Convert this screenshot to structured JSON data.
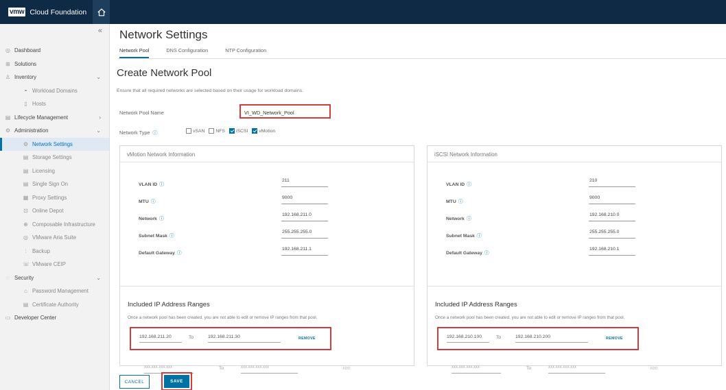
{
  "header": {
    "logo": "vmw",
    "title": "Cloud Foundation",
    "home_icon": "home-icon"
  },
  "sidebar": {
    "collapse": "«",
    "items": [
      {
        "label": "Dashboard",
        "icon": "dashboard-icon",
        "level": "top"
      },
      {
        "label": "Solutions",
        "icon": "solutions-icon",
        "level": "top"
      },
      {
        "label": "Inventory",
        "icon": "inventory-icon",
        "level": "top",
        "chevron": "⌄"
      },
      {
        "label": "Workload Domains",
        "icon": "workload-icon",
        "level": "sub"
      },
      {
        "label": "Hosts",
        "icon": "host-icon",
        "level": "sub"
      },
      {
        "label": "Lifecycle Management",
        "icon": "lifecycle-icon",
        "level": "top",
        "chevron": "›"
      },
      {
        "label": "Administration",
        "icon": "admin-icon",
        "level": "top",
        "chevron": "⌄"
      },
      {
        "label": "Network Settings",
        "icon": "network-icon",
        "level": "sub",
        "active": true
      },
      {
        "label": "Storage Settings",
        "icon": "storage-icon",
        "level": "sub"
      },
      {
        "label": "Licensing",
        "icon": "licensing-icon",
        "level": "sub"
      },
      {
        "label": "Single Sign On",
        "icon": "sso-icon",
        "level": "sub"
      },
      {
        "label": "Proxy Settings",
        "icon": "proxy-icon",
        "level": "sub"
      },
      {
        "label": "Online Depot",
        "icon": "depot-icon",
        "level": "sub"
      },
      {
        "label": "Composable Infrastructure",
        "icon": "composable-icon",
        "level": "sub"
      },
      {
        "label": "VMware Aria Suite",
        "icon": "aria-icon",
        "level": "sub"
      },
      {
        "label": "Backup",
        "icon": "backup-icon",
        "level": "sub"
      },
      {
        "label": "VMware CEIP",
        "icon": "ceip-icon",
        "level": "sub"
      },
      {
        "label": "Security",
        "icon": "security-icon",
        "level": "top",
        "chevron": "⌄"
      },
      {
        "label": "Password Management",
        "icon": "password-icon",
        "level": "sub"
      },
      {
        "label": "Certificate Authority",
        "icon": "certificate-icon",
        "level": "sub"
      },
      {
        "label": "Developer Center",
        "icon": "developer-icon",
        "level": "top"
      }
    ]
  },
  "main": {
    "title": "Network Settings",
    "tabs": [
      "Network Pool",
      "DNS Configuration",
      "NTP Configuration"
    ],
    "form_title": "Create Network Pool",
    "description": "Ensure that all required networks are selected based on their usage for workload domains.",
    "pool_name_label": "Network Pool Name",
    "pool_name_value": "VI_WD_Network_Pool",
    "network_type_label": "Network Type",
    "network_types": [
      {
        "label": "vSAN",
        "checked": false
      },
      {
        "label": "NFS",
        "checked": false
      },
      {
        "label": "iSCSI",
        "checked": true
      },
      {
        "label": "vMotion",
        "checked": true
      }
    ]
  },
  "cards": {
    "vmotion": {
      "title": "vMotion Network Information",
      "fields": [
        {
          "label": "VLAN ID",
          "value": "211"
        },
        {
          "label": "MTU",
          "value": "9000"
        },
        {
          "label": "Network",
          "value": "192.168.211.0"
        },
        {
          "label": "Subnet Mask",
          "value": "255.255.255.0"
        },
        {
          "label": "Default Gateway",
          "value": "192.168.211.1"
        }
      ],
      "ip_title": "Included IP Address Ranges",
      "ip_desc": "Once a network pool has been created, you are not able to edit or remove IP ranges from that pool.",
      "range_start": "192.168.211.20",
      "range_to": "To",
      "range_end": "192.168.211.30",
      "remove": "REMOVE",
      "add_start_placeholder": "xxx.xxx.xxx.xxx",
      "add_to": "To",
      "add_end_placeholder": "xxx.xxx.xxx.xxx",
      "add": "ADD"
    },
    "iscsi": {
      "title": "iSCSI Network Information",
      "fields": [
        {
          "label": "VLAN ID",
          "value": "210"
        },
        {
          "label": "MTU",
          "value": "9000"
        },
        {
          "label": "Network",
          "value": "192.168.210.0"
        },
        {
          "label": "Subnet Mask",
          "value": "255.255.255.0"
        },
        {
          "label": "Default Gateway",
          "value": "192.168.210.1"
        }
      ],
      "ip_title": "Included IP Address Ranges",
      "ip_desc": "Once a network pool has been created, you are not able to edit or remove IP ranges from that pool.",
      "range_start": "192.168.210.100",
      "range_to": "To",
      "range_end": "192.168.210.200",
      "remove": "REMOVE",
      "add_start_placeholder": "xxx.xxx.xxx.xxx",
      "add_to": "To",
      "add_end_placeholder": "xxx.xxx.xxx.xxx",
      "add": "ADD"
    }
  },
  "actions": {
    "cancel": "CANCEL",
    "save": "SAVE"
  },
  "colors": {
    "header": "#0e2a45",
    "accent": "#0072a3",
    "highlight": "#d23c3c"
  }
}
